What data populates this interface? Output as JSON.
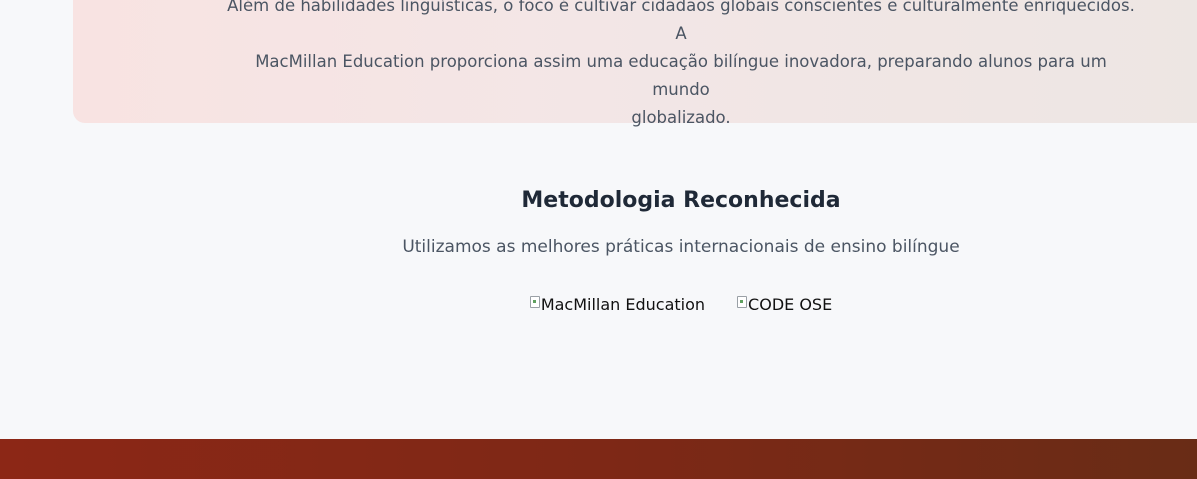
{
  "intro": {
    "text": "Além de habilidades linguísticas, o foco é cultivar cidadãos globais conscientes e culturalmente enriquecidos. A\nMacMillan Education proporciona assim uma educação bilíngue inovadora, preparando alunos para um mundo\nglobalizado."
  },
  "methodology": {
    "title": "Metodologia Reconhecida",
    "subtitle": "Utilizamos as melhores práticas internacionais de ensino bilíngue",
    "logos": [
      {
        "alt": "MacMillan Education"
      },
      {
        "alt": "CODE OSE"
      }
    ]
  },
  "colors": {
    "background": "#f7f8fa",
    "card_gradient_start": "#f8e3e2",
    "card_gradient_end": "#ede6e3",
    "footer_gradient_start": "#8c2716",
    "footer_gradient_end": "#692c16",
    "title": "#1f2937",
    "body_text": "#4b5563"
  },
  "icons": {
    "broken_image": "broken-image-icon"
  }
}
